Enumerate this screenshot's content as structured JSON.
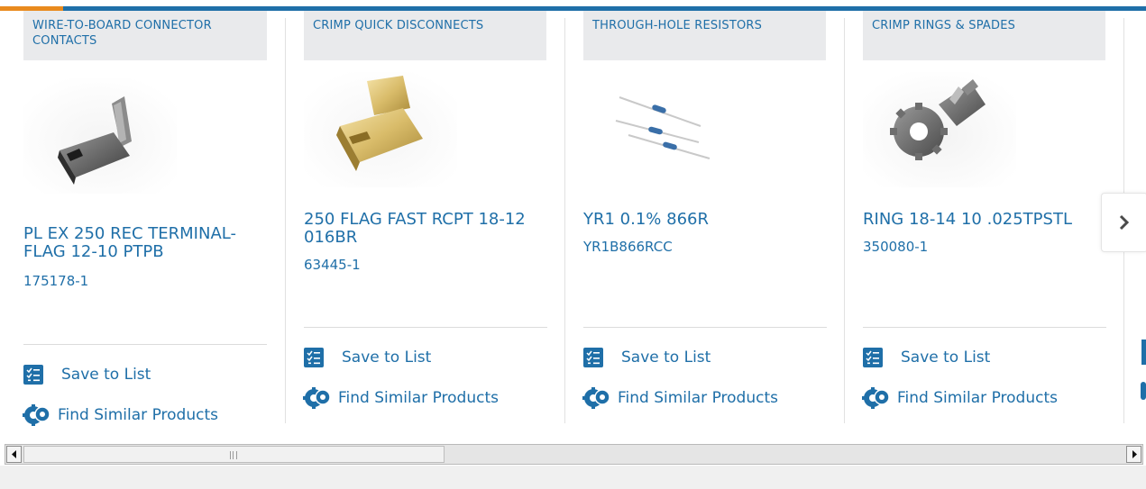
{
  "products": [
    {
      "category": "WIRE-TO-BOARD CONNECTOR CONTACTS",
      "title": "PL EX 250 REC TERMINAL-FLAG 12-10 PTPB",
      "part_number": "175178-1",
      "save_label": "Save to List",
      "similar_label": "Find Similar Products",
      "image": "gray-flag-terminal-image"
    },
    {
      "category": "CRIMP QUICK DISCONNECTS",
      "title": "250 FLAG FAST RCPT 18-12 016BR",
      "part_number": "63445-1",
      "save_label": "Save to List",
      "similar_label": "Find Similar Products",
      "image": "brass-flag-receptacle-image"
    },
    {
      "category": "THROUGH-HOLE RESISTORS",
      "title": "YR1 0.1% 866R",
      "part_number": "YR1B866RCC",
      "save_label": "Save to List",
      "similar_label": "Find Similar Products",
      "image": "resistors-image"
    },
    {
      "category": "CRIMP RINGS & SPADES",
      "title": "RING 18-14 10 .025TPSTL",
      "part_number": "350080-1",
      "save_label": "Save to List",
      "similar_label": "Find Similar Products",
      "image": "ring-terminal-image"
    }
  ],
  "carousel": {
    "next_icon": "chevron-right-icon"
  },
  "scrollbar": {
    "left_icon": "triangle-left-icon",
    "right_icon": "triangle-right-icon"
  },
  "colors": {
    "brand_blue": "#1f6fa8",
    "accent_orange": "#e98a1e",
    "category_bg": "#e9eaec"
  }
}
